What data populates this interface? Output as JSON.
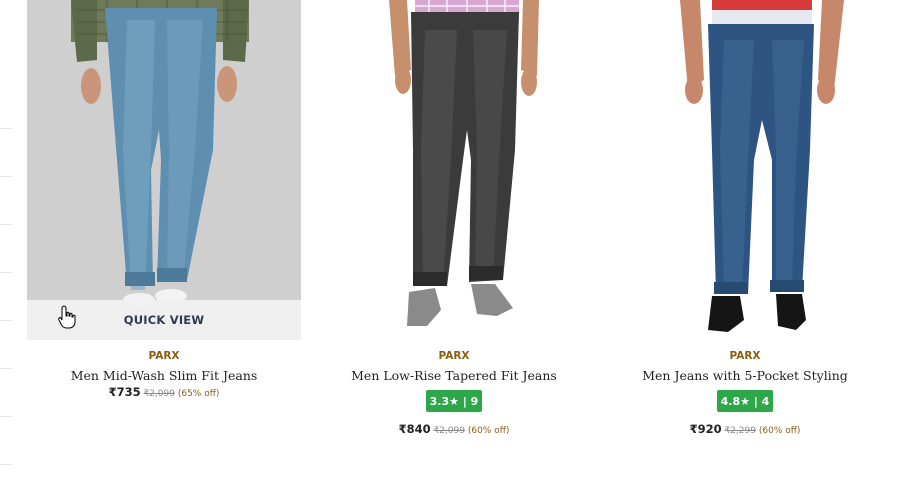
{
  "products": [
    {
      "brand": "PARX",
      "name": "Men Mid-Wash Slim Fit Jeans",
      "price": "₹735",
      "mrp": "₹2,099",
      "discount": "(65% off)",
      "quick_view_label": "QUICK VIEW",
      "image_icon": "product-photo-jeans-mid-wash"
    },
    {
      "brand": "PARX",
      "name": "Men Low-Rise Tapered Fit Jeans",
      "rating": "3.3★ | 9",
      "price": "₹840",
      "mrp": "₹2,099",
      "discount": "(60% off)",
      "image_icon": "product-photo-jeans-black"
    },
    {
      "brand": "PARX",
      "name": "Men Jeans with 5-Pocket Styling",
      "rating": "4.8★ | 4",
      "price": "₹920",
      "mrp": "₹2,299",
      "discount": "(60% off)",
      "image_icon": "product-photo-jeans-dark-blue"
    }
  ],
  "colors": {
    "brand": "#8b5e12",
    "rating_badge": "#2ea64a",
    "quick_view_text": "#2f3b4c"
  }
}
